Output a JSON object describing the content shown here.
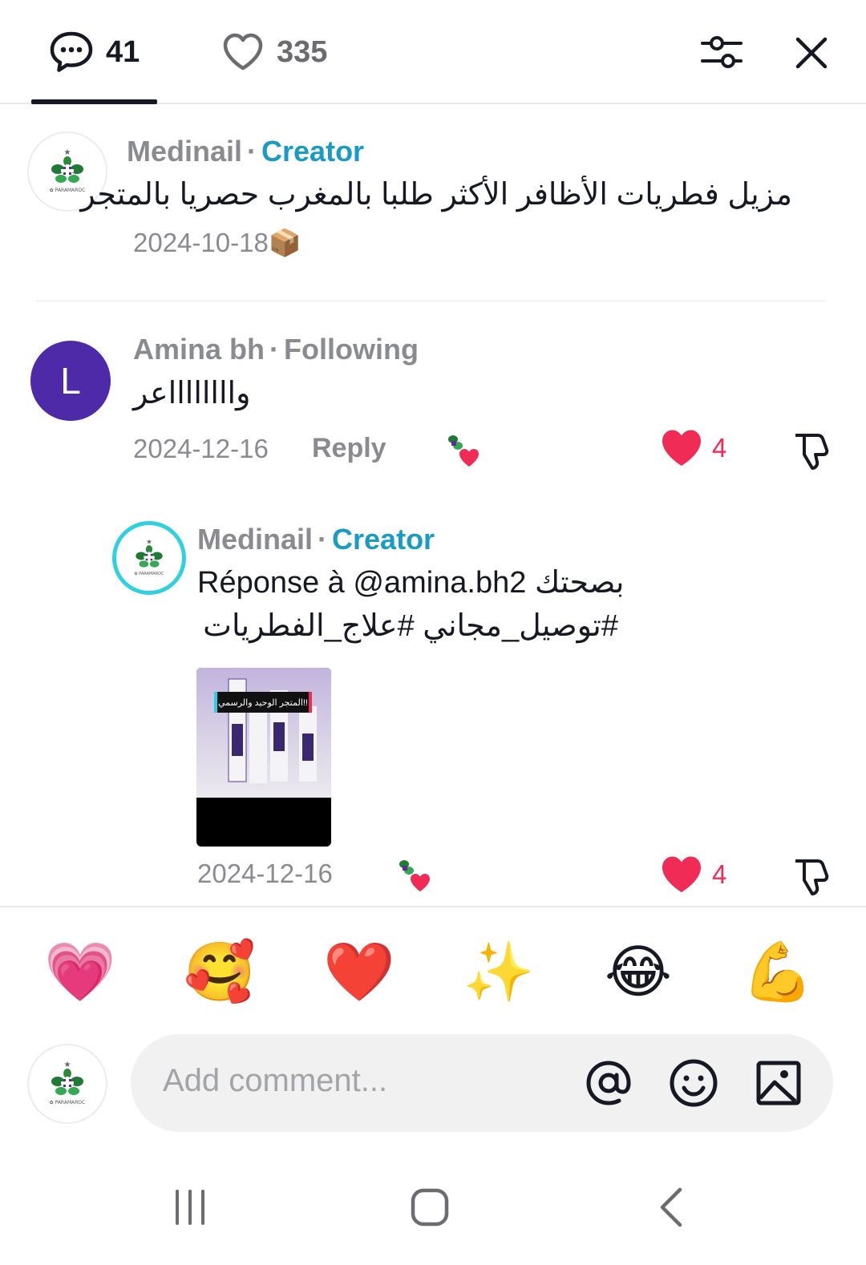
{
  "header": {
    "comments_count": "41",
    "likes_count": "335"
  },
  "pinned_comment": {
    "author": "Medinail",
    "dot": "·",
    "badge": "Creator",
    "text": "مزيل فطريات الأظافر الأكثر طلبا بالمغرب حصريا بالمتجر",
    "date": "2024-10-18📦"
  },
  "comment": {
    "avatar_letter": "L",
    "author": "Amina bh",
    "dot": "·",
    "badge": "Following",
    "text": "وااااااااعر",
    "date": "2024-12-16",
    "reply_label": "Reply",
    "likes": "4"
  },
  "reply": {
    "author": "Medinail",
    "dot": "·",
    "badge": "Creator",
    "text_line1": "Réponse à @amina.bh2 بصحتك",
    "text_line2": "#توصيل_مجاني  #علاج_الفطريات",
    "thumb_label": "المتجر الوحيد والرسمي!!",
    "date": "2024-12-16",
    "likes": "4"
  },
  "emoji_bar": [
    "💗",
    "🥰",
    "❤️",
    "✨",
    "😂",
    "💪"
  ],
  "input": {
    "placeholder": "Add comment..."
  },
  "colors": {
    "accent_creator": "#1a9bc4",
    "like_red": "#f02c56",
    "avatar_purple": "#4f2aa8"
  }
}
